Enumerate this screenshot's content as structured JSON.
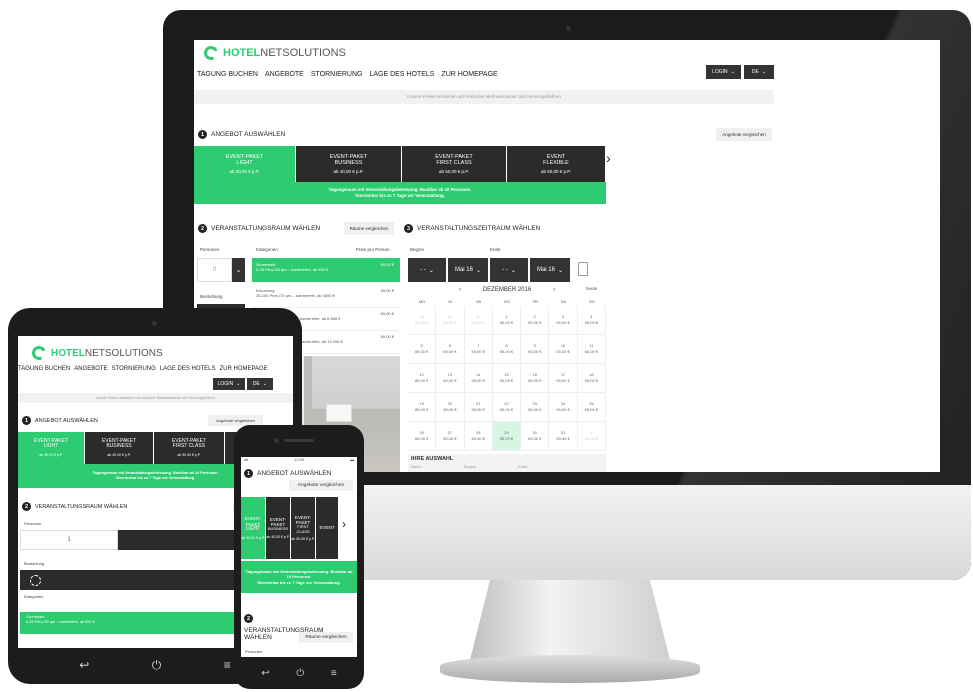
{
  "brand": {
    "word1": "HOTEL",
    "word2": "NETSOLUTIONS",
    "color": "#2ecc71"
  },
  "nav": [
    "TAGUNG BUCHEN",
    "ANGEBOTE",
    "STORNIERUNG",
    "LAGE DES HOTELS",
    "ZUR HOMEPAGE"
  ],
  "login_label": "LOGIN",
  "lang_label": "DE",
  "notice": "Unsere Preise verstehen sich inklusive Mehrwertsteuer und Servicegebühren",
  "section1": {
    "number": "1",
    "title": "ANGEBOT AUSWÄHLEN",
    "compare": "Angebote vergleichen"
  },
  "packages": [
    {
      "line1": "EVENT-PAKET",
      "line2": "LIGHT",
      "price": "ab 30,00 € p.P.",
      "selected": true
    },
    {
      "line1": "EVENT-PAKET",
      "line2": "BUSINESS",
      "price": "ab 40,00 € p.P.",
      "selected": false
    },
    {
      "line1": "EVENT-PAKET",
      "line2": "FIRST CLASS",
      "price": "ab 50,00 € p.P.",
      "selected": false
    },
    {
      "line1": "EVENT",
      "line2": "FLEXIBLE",
      "price": "ab 60,00 € p.P.",
      "selected": false
    }
  ],
  "banner": {
    "line1": "Tagungsraum mit Veranstaltungsbetreuung. Buchbar ab 10 Personen.",
    "line2": "Stornierbar bis zu 7 Tage vor Veranstaltung."
  },
  "section2": {
    "number": "2",
    "title": "VERANSTALTUNGSRAUM WÄHLEN",
    "compare": "Räume vergleichen"
  },
  "room_filters": {
    "persons_label": "Personen",
    "persons_value": "0",
    "seating_label": "Bestuhlung",
    "categories_label": "Kategorien",
    "price_label": "Preis pro Person"
  },
  "rooms": [
    {
      "name": "Grunewald",
      "desc": "0-25 Pers./30 qm – barrierefrei, ab 600 €",
      "price": "65,00 €",
      "selected": true
    },
    {
      "name": "Kreuzberg",
      "desc": "26-100 Pers./70 qm – barrierefrei, ab 1690 €",
      "price": "65,00 €",
      "selected": false
    },
    {
      "name": "Mitte",
      "desc": "101-200 Pers./150 qm – barrierefrei, ab 6 565 €",
      "price": "65,00 €",
      "selected": false
    },
    {
      "name": "Friedrichshain",
      "desc": "200-500 Pers./250 qm – barrierefrei, ab 13 000 €",
      "price": "65,00 €",
      "selected": false
    }
  ],
  "section3": {
    "number": "3",
    "title": "VERANSTALTUNGSZEITRAUM WÄHLEN"
  },
  "period": {
    "begin_label": "Beginn",
    "end_label": "Ende",
    "time_placeholder": "- -",
    "begin_date": "Mai 16",
    "end_date": "Mai 16"
  },
  "calendar": {
    "month": "DEZEMBER 2016",
    "today": "heute",
    "weekdays": [
      "MO",
      "DI",
      "MI",
      "DO",
      "FR",
      "SA",
      "SO"
    ],
    "price": "65,00 €",
    "days": [
      "28",
      "29",
      "30",
      "1",
      "2",
      "3",
      "4",
      "5",
      "6",
      "7",
      "8",
      "9",
      "10",
      "11",
      "12",
      "13",
      "14",
      "15",
      "16",
      "17",
      "18",
      "19",
      "20",
      "21",
      "22",
      "23",
      "24",
      "25",
      "26",
      "27",
      "28",
      "29",
      "30",
      "31",
      "1"
    ],
    "selected_day_index": 31
  },
  "selection": {
    "title": "IHRE AUSWAHL",
    "col1": "Raum",
    "col2": "Beginn",
    "col3": "Ende"
  },
  "tablet": {
    "persons_value": "1",
    "seating_label": "Bestuhlung",
    "categories_label": "Kategorien",
    "room_compare": "Räume"
  },
  "phone": {
    "status_left": "atl",
    "status_time": "12:00"
  }
}
